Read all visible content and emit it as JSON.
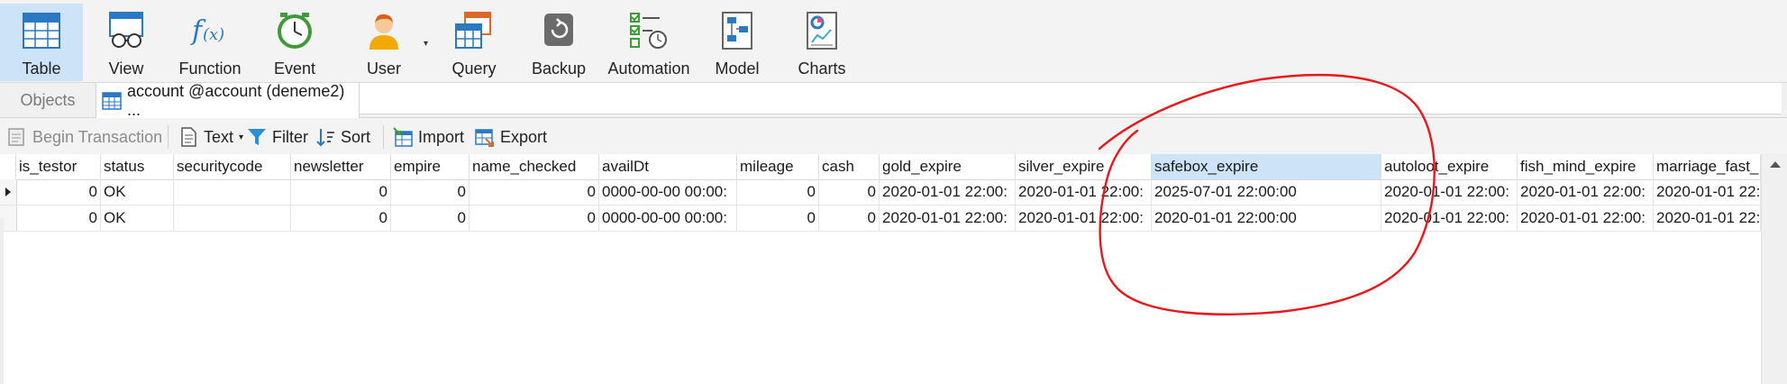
{
  "ribbon": {
    "items": [
      {
        "label": "Table",
        "icon": "table-icon",
        "active": true
      },
      {
        "label": "View",
        "icon": "view-glasses-icon",
        "active": false
      },
      {
        "label": "Function",
        "icon": "function-fx-icon",
        "active": false
      },
      {
        "label": "Event",
        "icon": "event-clock-icon",
        "active": false
      },
      {
        "label": "User",
        "icon": "user-icon",
        "active": false
      },
      {
        "label": "Query",
        "icon": "query-icon",
        "active": false
      },
      {
        "label": "Backup",
        "icon": "backup-icon",
        "active": false
      },
      {
        "label": "Automation",
        "icon": "automation-icon",
        "active": false
      },
      {
        "label": "Model",
        "icon": "model-icon",
        "active": false
      },
      {
        "label": "Charts",
        "icon": "charts-icon",
        "active": false
      }
    ]
  },
  "tabs": {
    "objects_label": "Objects",
    "active_label": "account @account (deneme2) ..."
  },
  "toolbar": {
    "begin_transaction": "Begin Transaction",
    "text": "Text",
    "filter": "Filter",
    "sort": "Sort",
    "import": "Import",
    "export": "Export"
  },
  "grid": {
    "columns": [
      "is_testor",
      "status",
      "securitycode",
      "newsletter",
      "empire",
      "name_checked",
      "availDt",
      "mileage",
      "cash",
      "gold_expire",
      "silver_expire",
      "safebox_expire",
      "autoloot_expire",
      "fish_mind_expire",
      "marriage_fast_"
    ],
    "selected_column": "safebox_expire",
    "rows": [
      [
        "0",
        "OK",
        "",
        "0",
        "0",
        "0",
        "0000-00-00 00:00:",
        "0",
        "0",
        "2020-01-01 22:00:",
        "2020-01-01 22:00:",
        "2025-07-01 22:00:00",
        "2020-01-01 22:00:",
        "2020-01-01 22:00:",
        "2020-01-01 22:"
      ],
      [
        "0",
        "OK",
        "",
        "0",
        "0",
        "0",
        "0000-00-00 00:00:",
        "0",
        "0",
        "2020-01-01 22:00:",
        "2020-01-01 22:00:",
        "2020-01-01 22:00:00",
        "2020-01-01 22:00:",
        "2020-01-01 22:00:",
        "2020-01-01 22:"
      ]
    ],
    "current_row": 0
  },
  "colors": {
    "accent": "#cde3f7",
    "annotation": "#e8171b",
    "icon_blue": "#2b79c2"
  }
}
